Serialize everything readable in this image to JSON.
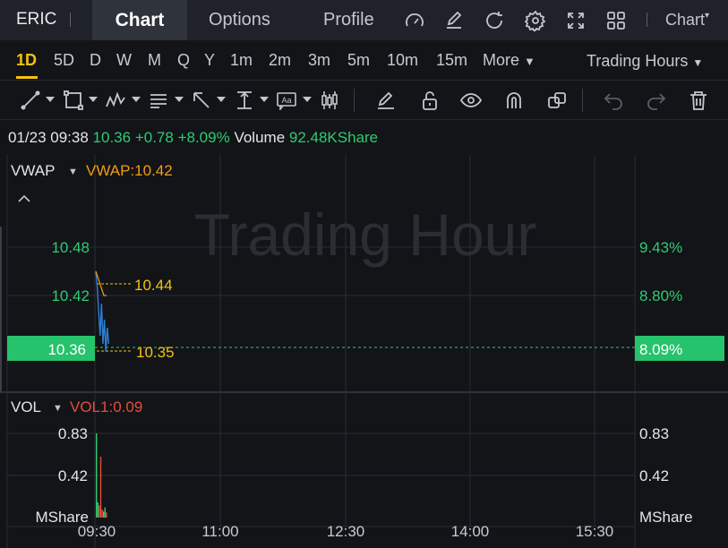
{
  "header": {
    "ticker": "ERIC",
    "tabs": {
      "chart": "Chart",
      "options": "Options",
      "profile": "Profile"
    },
    "chart_dropdown": "Chart",
    "icons": [
      "speedometer-icon",
      "edit-icon",
      "refresh-icon",
      "settings-icon",
      "fullscreen-icon",
      "grid-icon"
    ]
  },
  "periods": {
    "items": [
      "1D",
      "5D",
      "D",
      "W",
      "M",
      "Q",
      "Y",
      "1m",
      "2m",
      "3m",
      "5m",
      "10m",
      "15m"
    ],
    "more": "More",
    "active": "1D",
    "trading_hours": "Trading Hours"
  },
  "toolbar": {
    "icons": [
      "line-tool-icon",
      "rectangle-tool-icon",
      "pattern-tool-icon",
      "fib-tool-icon",
      "arrow-tool-icon",
      "measure-tool-icon",
      "text-tool-icon",
      "candle-tool-icon",
      "pen-icon",
      "lock-icon",
      "eye-icon",
      "magnet-icon",
      "copy-icon",
      "undo-icon",
      "redo-icon",
      "trash-icon"
    ]
  },
  "info": {
    "datetime": "01/23 09:38",
    "price": "10.36",
    "change": "+0.78",
    "change_pct": "+8.09%",
    "volume_label": "Volume",
    "volume": "92.48KShare"
  },
  "price_panel": {
    "indicator": "VWAP",
    "indicator_value": "VWAP:10.42",
    "watermark": "Trading Hour",
    "left_labels": [
      "10.48",
      "10.42"
    ],
    "right_labels": [
      "9.43%",
      "8.80%"
    ],
    "current_price": "10.36",
    "current_pct": "8.09%",
    "vwap_high_marker": "10.44",
    "vwap_low_marker": "10.35"
  },
  "volume_panel": {
    "indicator": "VOL",
    "indicator_value": "VOL1:0.09",
    "left_labels": [
      "0.83",
      "0.42",
      "MShare"
    ],
    "right_labels": [
      "0.83",
      "0.42",
      "MShare"
    ]
  },
  "time_axis": [
    "09:30",
    "11:00",
    "12:30",
    "14:00",
    "15:30"
  ],
  "colors": {
    "up": "#2ecc71",
    "vwap": "#f39c12",
    "vol_label": "#e74c3c",
    "marker": "#f4c20d",
    "price_line": "#2d7fd4",
    "active": "#f4c20d"
  },
  "chart_data": {
    "type": "line",
    "price_series": [
      10.45,
      10.43,
      10.4,
      10.37,
      10.41,
      10.36,
      10.39,
      10.35,
      10.38,
      10.36
    ],
    "vwap_series": [
      10.45,
      10.44,
      10.43,
      10.42,
      10.42
    ],
    "volume_series": [
      0.83,
      0.15,
      0.12,
      0.6,
      0.08,
      0.06,
      0.1,
      0.05
    ],
    "volume_colors": [
      "up",
      "up",
      "down",
      "down",
      "down",
      "up",
      "up",
      "down"
    ]
  }
}
